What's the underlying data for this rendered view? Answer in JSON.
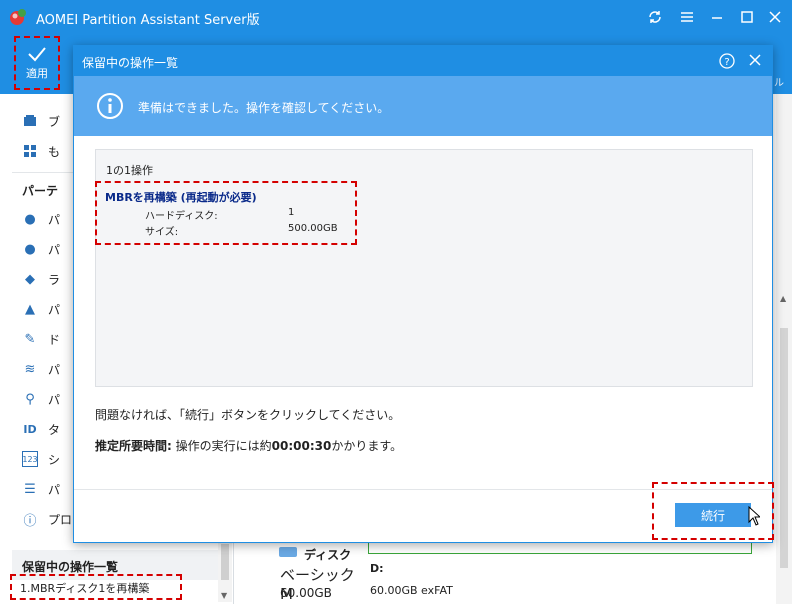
{
  "app": {
    "title": "AOMEI Partition Assistant Server版",
    "brand_color": "#1f8ee3"
  },
  "toolbar": {
    "apply_label": "適用",
    "right_fragment": "ル"
  },
  "sidebar": {
    "top_items": [
      {
        "label": "ブ",
        "icon": "boot-icon"
      },
      {
        "label": "も",
        "icon": "more-icon"
      }
    ],
    "section_title": "パーテ",
    "items": [
      {
        "label": "パ",
        "icon": "pie-icon"
      },
      {
        "label": "パ",
        "icon": "pie-check-icon"
      },
      {
        "label": "ラ",
        "icon": "tag-icon"
      },
      {
        "label": "パ",
        "icon": "broom-icon"
      },
      {
        "label": "ド",
        "icon": "pencil-icon"
      },
      {
        "label": "パ",
        "icon": "eye-hide-icon"
      },
      {
        "label": "パ",
        "icon": "search-icon"
      },
      {
        "label": "タ",
        "icon": "id-icon"
      },
      {
        "label": "シ",
        "icon": "serial-icon"
      },
      {
        "label": "パ",
        "icon": "align-icon"
      },
      {
        "label": "プロ",
        "icon": "info-icon"
      }
    ],
    "pending_title": "保留中の操作一覧",
    "pending_item": "1.MBRディスク1を再構築"
  },
  "main": {
    "disk_name": "ディスク",
    "disk_type": "ベーシック M",
    "disk_size": "60.00GB",
    "partition_letter": "D:",
    "partition_info": "60.00GB exFAT"
  },
  "dialog": {
    "title": "保留中の操作一覧",
    "banner_message": "準備はできました。操作を確認してください。",
    "op_count": "1の1操作",
    "operation": {
      "title": "MBRを再構築 (再起動が必要)",
      "rows": [
        {
          "label": "ハードディスク:",
          "value": "1"
        },
        {
          "label": "サイズ:",
          "value": "500.00GB"
        }
      ]
    },
    "note": "問題なければ、「続行」ボタンをクリックしてください。",
    "time_label": "推定所要時間:",
    "time_prefix": " 操作の実行には約",
    "time_value": "00:00:30",
    "time_suffix": "かかります。",
    "continue_label": "続行"
  }
}
